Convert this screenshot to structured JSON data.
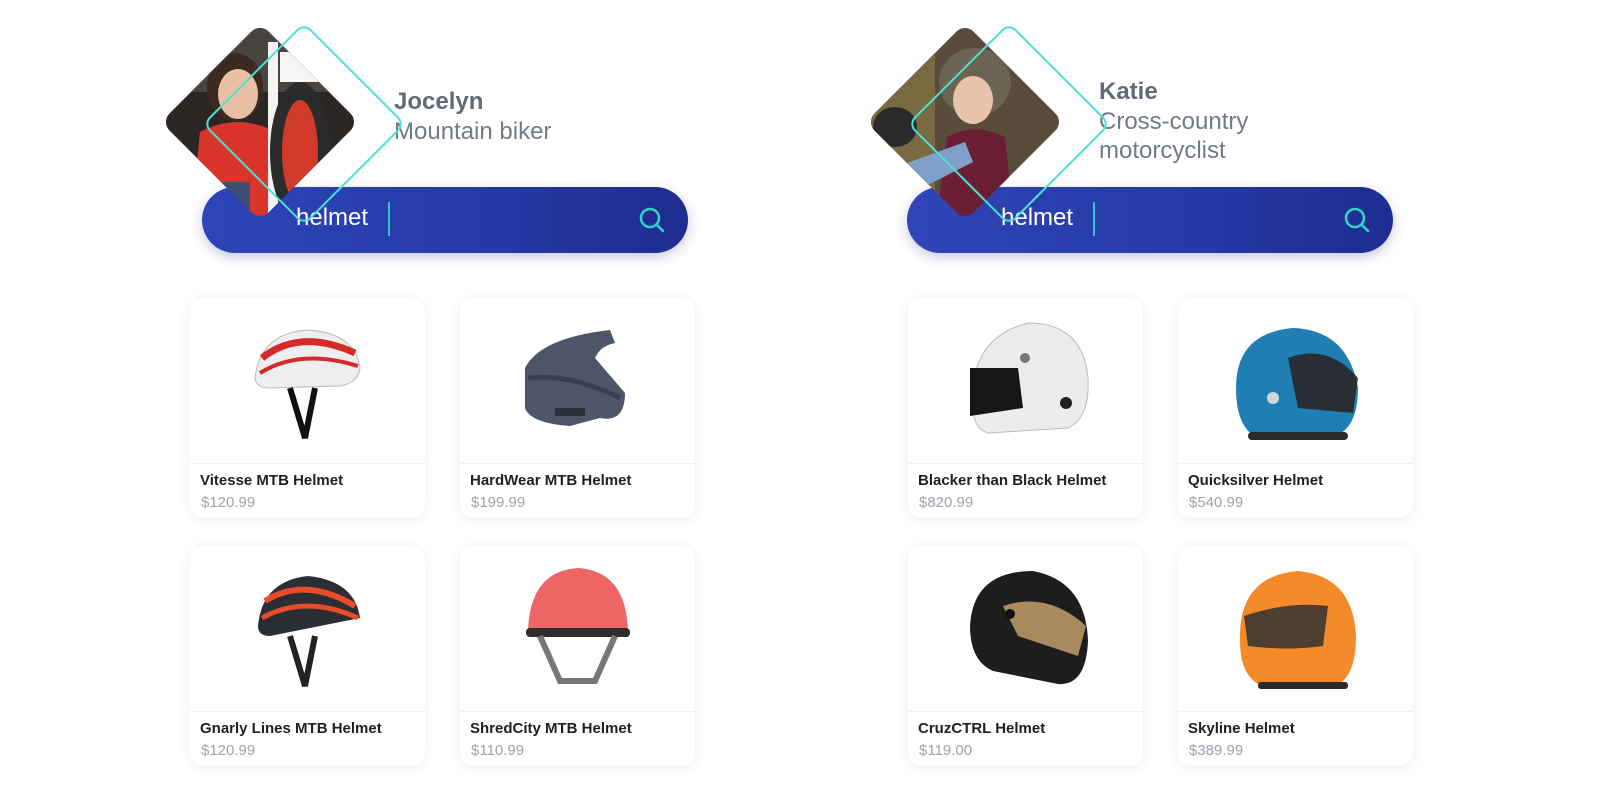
{
  "personas": [
    {
      "name": "Jocelyn",
      "role_lines": [
        "Mountain biker"
      ],
      "photo": "woman-with-mountain-bike-photo",
      "search": {
        "value": "helmet",
        "icon": "search-icon"
      },
      "products": [
        {
          "name": "Vitesse MTB Helmet",
          "price": "$120.99",
          "image": "white-red-bike-helmet"
        },
        {
          "name": "HardWear MTB Helmet",
          "price": "$199.99",
          "image": "grey-full-face-mtb-helmet"
        },
        {
          "name": "Gnarly Lines MTB Helmet",
          "price": "$120.99",
          "image": "red-black-bike-helmet"
        },
        {
          "name": "ShredCity MTB Helmet",
          "price": "$110.99",
          "image": "pink-skate-helmet"
        }
      ]
    },
    {
      "name": "Katie",
      "role_lines": [
        "Cross-country",
        "motorcyclist"
      ],
      "photo": "woman-trying-motorcycle-helmet-photo",
      "search": {
        "value": "helmet",
        "icon": "search-icon"
      },
      "products": [
        {
          "name": "Blacker than Black Helmet",
          "price": "$820.99",
          "image": "white-racing-helmet"
        },
        {
          "name": "Quicksilver  Helmet",
          "price": "$540.99",
          "image": "blue-modular-motorcycle-helmet"
        },
        {
          "name": "CruzCTRL Helmet",
          "price": "$119.00",
          "image": "black-gold-motorcycle-helmet"
        },
        {
          "name": "Skyline Helmet",
          "price": "$389.99",
          "image": "orange-full-face-motorcycle-helmet"
        }
      ]
    }
  ],
  "colors": {
    "accent_teal": "#4de0d3",
    "search_bar": "#2a3cae",
    "name_text": "#636a77",
    "price_text": "#9ea3ab"
  }
}
